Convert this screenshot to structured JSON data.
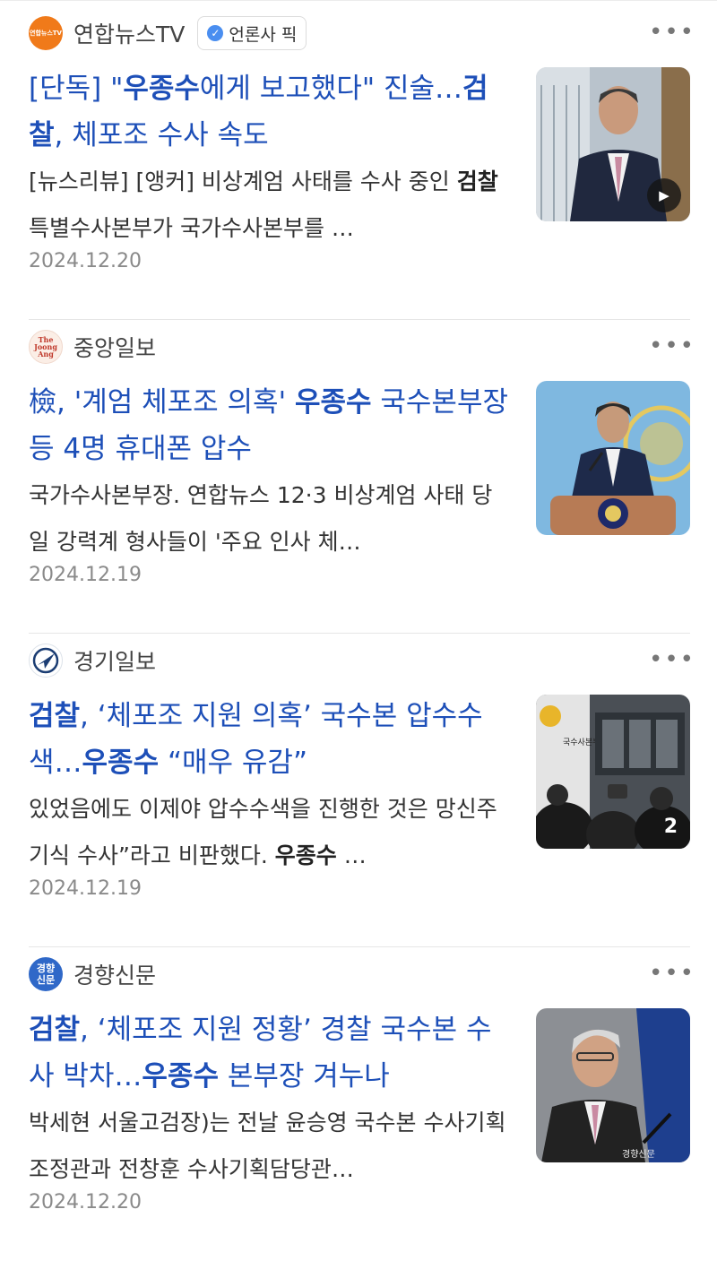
{
  "articles": [
    {
      "press": "연합뉴스TV",
      "logo_text": "연합뉴스TV",
      "pick_label": "언론사 픽",
      "more": "•••",
      "title": [
        {
          "t": "[단독] \"",
          "b": false
        },
        {
          "t": "우종수",
          "b": true
        },
        {
          "t": "에게 보고했다\" 진술…",
          "b": false
        },
        {
          "t": "검찰",
          "b": true
        },
        {
          "t": ", 체포조 수사 속도",
          "b": false
        }
      ],
      "summary": [
        {
          "t": "[뉴스리뷰] [앵커] 비상계엄 사태를 수사 중인 ",
          "b": false
        },
        {
          "t": "검찰",
          "b": true
        },
        {
          "t": " 특별수사본부가 국가수사본부를 …",
          "b": false
        }
      ],
      "date": "2024.12.20",
      "thumb_overlay": "▶"
    },
    {
      "press": "중앙일보",
      "logo_text": "The Joong Ang",
      "more": "•••",
      "title": [
        {
          "t": "檢, '계엄 체포조 의혹' ",
          "b": false
        },
        {
          "t": "우종수",
          "b": true
        },
        {
          "t": " 국수본부장 등 4명 휴대폰 압수",
          "b": false
        }
      ],
      "summary": [
        {
          "t": "국가수사본부장. 연합뉴스 12·3 비상계엄 사태 당일 강력계 형사들이 '주요 인사 체…",
          "b": false
        }
      ],
      "date": "2024.12.19"
    },
    {
      "press": "경기일보",
      "more": "•••",
      "title": [
        {
          "t": "검찰",
          "b": true
        },
        {
          "t": ", ‘체포조 지원 의혹’ 국수본 압수수색…",
          "b": false
        },
        {
          "t": "우종수",
          "b": true
        },
        {
          "t": " “매우 유감”",
          "b": false
        }
      ],
      "summary": [
        {
          "t": "있었음에도 이제야 압수수색을 진행한 것은 망신주기식 수사”라고 비판했다. ",
          "b": false
        },
        {
          "t": "우종수",
          "b": true
        },
        {
          "t": " …",
          "b": false
        }
      ],
      "date": "2024.12.19",
      "thumb_overlay": "2",
      "thumb_sign": "국수사본부"
    },
    {
      "press": "경향신문",
      "logo_text": "경향 신문",
      "more": "•••",
      "title": [
        {
          "t": "검찰",
          "b": true
        },
        {
          "t": ", ‘체포조 지원 정황’ 경찰 국수본 수사 박차…",
          "b": false
        },
        {
          "t": "우종수",
          "b": true
        },
        {
          "t": " 본부장 겨누나",
          "b": false
        }
      ],
      "summary": [
        {
          "t": "박세현 서울고검장)는 전날 윤승영 국수본 수사기획조정관과 전창훈 수사기획담당관…",
          "b": false
        }
      ],
      "date": "2024.12.20",
      "thumb_watermark": "경향신문"
    }
  ],
  "colors": {
    "title": "#1d4fb8",
    "date": "#8a8a8a",
    "pick_check": "#4a8ef0"
  }
}
